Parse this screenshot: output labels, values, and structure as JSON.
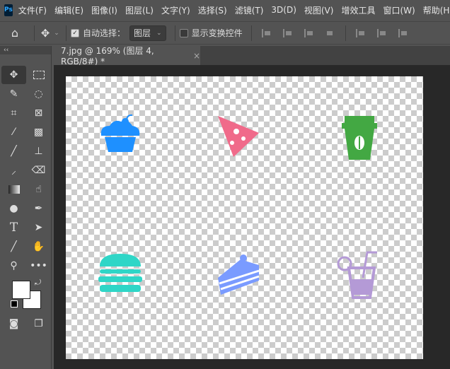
{
  "app": {
    "logo": "Ps"
  },
  "menu": [
    "文件(F)",
    "编辑(E)",
    "图像(I)",
    "图层(L)",
    "文字(Y)",
    "选择(S)",
    "滤镜(T)",
    "3D(D)",
    "视图(V)",
    "增效工具",
    "窗口(W)",
    "帮助(H)"
  ],
  "options": {
    "auto_select_label": "自动选择：",
    "auto_select_checked": true,
    "target_value": "图层",
    "show_transform_label": "显示变换控件",
    "show_transform_checked": false
  },
  "tab": {
    "title": "7.jpg @ 169% (图层 4, RGB/8#) *",
    "close": "×"
  },
  "toolbar": {
    "collapse": "‹‹"
  },
  "canvas_icons": [
    {
      "name": "cupcake",
      "color": "#1e90ff"
    },
    {
      "name": "pizza",
      "color": "#f06a8a"
    },
    {
      "name": "coffee-cup",
      "color": "#43a843"
    },
    {
      "name": "burger",
      "color": "#2fd6c7"
    },
    {
      "name": "cake-slice",
      "color": "#7a9bff"
    },
    {
      "name": "drink",
      "color": "#b49ad6"
    }
  ]
}
